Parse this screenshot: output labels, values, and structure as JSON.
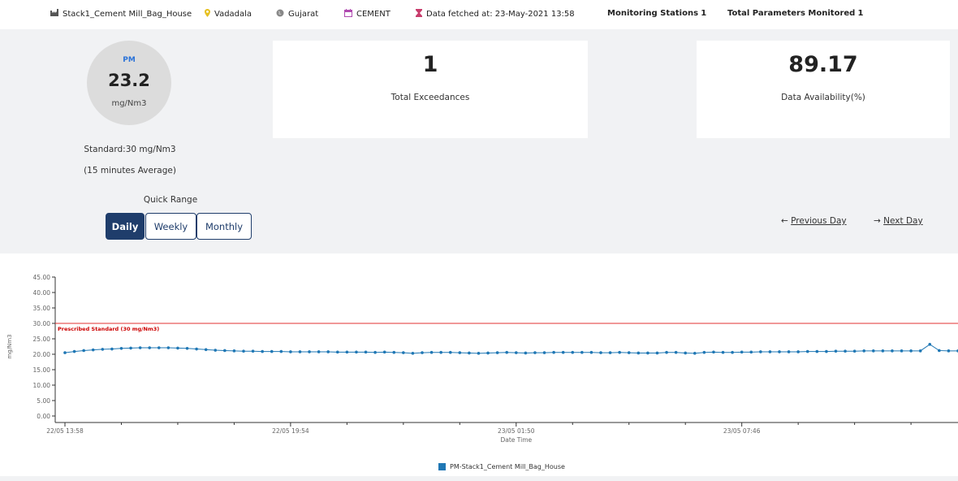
{
  "topbar": {
    "station": "Stack1_Cement Mill_Bag_House",
    "city": "Vadadala",
    "state": "Gujarat",
    "industry": "CEMENT",
    "fetched": "Data fetched at: 23-May-2021 13:58",
    "monitoring_label": "Monitoring Stations",
    "monitoring_value": "1",
    "params_label": "Total Parameters Monitored",
    "params_value": "1",
    "colors": {
      "station_icon": "#555555",
      "city_icon": "#e6c020",
      "state_icon": "#888888",
      "industry_icon": "#b04ab0",
      "fetched_icon": "#c83c6c"
    }
  },
  "summary": {
    "parameter": "PM",
    "value": "23.2",
    "unit": "mg/Nm3",
    "standard": "Standard:30 mg/Nm3",
    "average": "(15 minutes  Average)",
    "quick_range_label": "Quick Range",
    "ranges": [
      "Daily",
      "Weekly",
      "Monthly"
    ],
    "active_range": "Daily",
    "exceedances_value": "1",
    "exceedances_label": "Total Exceedances",
    "availability_value": "89.17",
    "availability_label": "Data Availability(%)",
    "prev_day": "Previous Day",
    "next_day": "Next Day"
  },
  "chart_data": {
    "type": "line",
    "ylabel": "mg/Nm3",
    "xlabel": "Date Time",
    "ylim": [
      0,
      45
    ],
    "yticks": [
      "0.00",
      "5.00",
      "10.00",
      "15.00",
      "20.00",
      "25.00",
      "30.00",
      "35.00",
      "40.00",
      "45.00"
    ],
    "xticks": [
      "22/05 13:58",
      "22/05 19:54",
      "23/05 01:50",
      "23/05 07:46"
    ],
    "standard_line": {
      "value": 30,
      "label": "Prescribed Standard (30 mg/Nm3)",
      "color": "#e03030"
    },
    "series": [
      {
        "name": "PM-Stack1_Cement Mill_Bag_House",
        "color": "#1f77b4",
        "values": [
          20.5,
          20.9,
          21.2,
          21.4,
          21.6,
          21.7,
          21.9,
          22.0,
          22.1,
          22.1,
          22.1,
          22.1,
          22.0,
          21.9,
          21.7,
          21.5,
          21.3,
          21.2,
          21.1,
          21.0,
          21.0,
          20.9,
          20.9,
          20.9,
          20.8,
          20.8,
          20.8,
          20.8,
          20.8,
          20.7,
          20.7,
          20.7,
          20.7,
          20.6,
          20.7,
          20.6,
          20.5,
          20.3,
          20.5,
          20.6,
          20.6,
          20.6,
          20.5,
          20.4,
          20.3,
          20.4,
          20.5,
          20.6,
          20.5,
          20.4,
          20.5,
          20.5,
          20.6,
          20.6,
          20.6,
          20.6,
          20.6,
          20.5,
          20.5,
          20.6,
          20.5,
          20.4,
          20.4,
          20.4,
          20.6,
          20.6,
          20.4,
          20.3,
          20.6,
          20.7,
          20.6,
          20.6,
          20.7,
          20.7,
          20.8,
          20.8,
          20.8,
          20.8,
          20.8,
          20.9,
          20.9,
          20.9,
          21.0,
          21.0,
          21.0,
          21.1,
          21.1,
          21.1,
          21.1,
          21.1,
          21.1,
          21.1,
          23.2,
          21.2,
          21.1,
          21.1
        ]
      }
    ]
  }
}
